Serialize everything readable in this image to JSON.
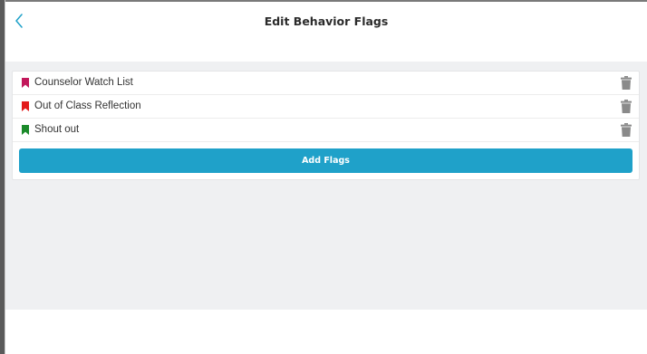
{
  "header": {
    "title": "Edit Behavior Flags",
    "back_icon": "chevron-left-icon"
  },
  "flags": [
    {
      "label": "Counselor Watch List",
      "color": "#c2185b",
      "icon": "bookmark-icon",
      "action_icon": "trash-icon"
    },
    {
      "label": "Out of Class Reflection",
      "color": "#e31b1b",
      "icon": "bookmark-icon",
      "action_icon": "trash-icon"
    },
    {
      "label": "Shout out",
      "color": "#1b8a2a",
      "icon": "bookmark-icon",
      "action_icon": "trash-icon"
    }
  ],
  "actions": {
    "add_label": "Add Flags"
  },
  "colors": {
    "accent": "#1fa1c9",
    "background": "#eff0f2",
    "trash": "#8a8a8a"
  }
}
